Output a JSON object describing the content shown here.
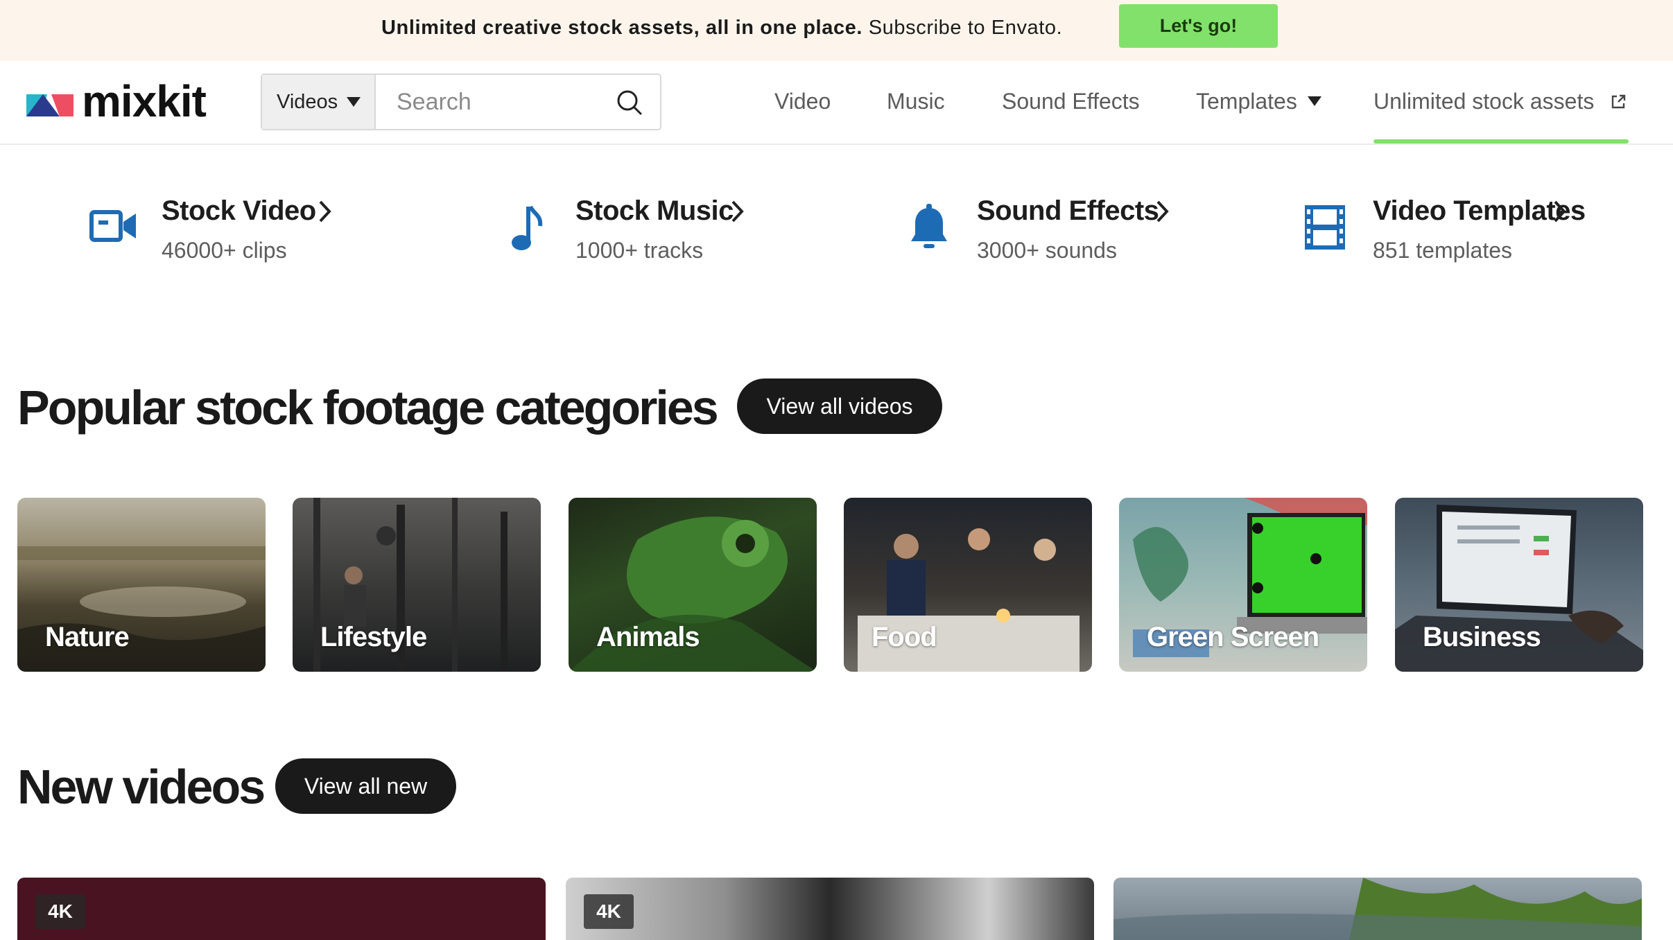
{
  "promo": {
    "bold_text": "Unlimited creative stock assets, all in one place.",
    "text": " Subscribe to Envato.",
    "button_label": "Let's go!"
  },
  "header": {
    "logo_text": "mixkit",
    "search": {
      "select_value": "Videos",
      "placeholder": "Search"
    },
    "nav": [
      {
        "label": "Video"
      },
      {
        "label": "Music"
      },
      {
        "label": "Sound Effects"
      },
      {
        "label": "Templates"
      },
      {
        "label": "Unlimited stock assets"
      }
    ]
  },
  "categories": [
    {
      "title": "Stock Video",
      "subtitle": "46000+ clips",
      "icon": "video-camera-icon"
    },
    {
      "title": "Stock Music",
      "subtitle": "1000+ tracks",
      "icon": "music-note-icon"
    },
    {
      "title": "Sound Effects",
      "subtitle": "3000+ sounds",
      "icon": "bell-icon"
    },
    {
      "title": "Video Templates",
      "subtitle": "851 templates",
      "icon": "film-strip-icon"
    }
  ],
  "popular": {
    "title": "Popular stock footage categories",
    "button_label": "View all videos",
    "tiles": [
      {
        "label": "Nature"
      },
      {
        "label": "Lifestyle"
      },
      {
        "label": "Animals"
      },
      {
        "label": "Food"
      },
      {
        "label": "Green Screen"
      },
      {
        "label": "Business"
      }
    ]
  },
  "new_videos": {
    "title": "New videos",
    "button_label": "View all new",
    "cards": [
      {
        "badge": "4K"
      },
      {
        "badge": "4K"
      },
      {
        "badge": ""
      }
    ]
  },
  "colors": {
    "accent_green": "#82e16a",
    "icon_blue": "#1e6bb5",
    "promo_bg": "#fdf5ec",
    "dark": "#1a1a1a"
  }
}
